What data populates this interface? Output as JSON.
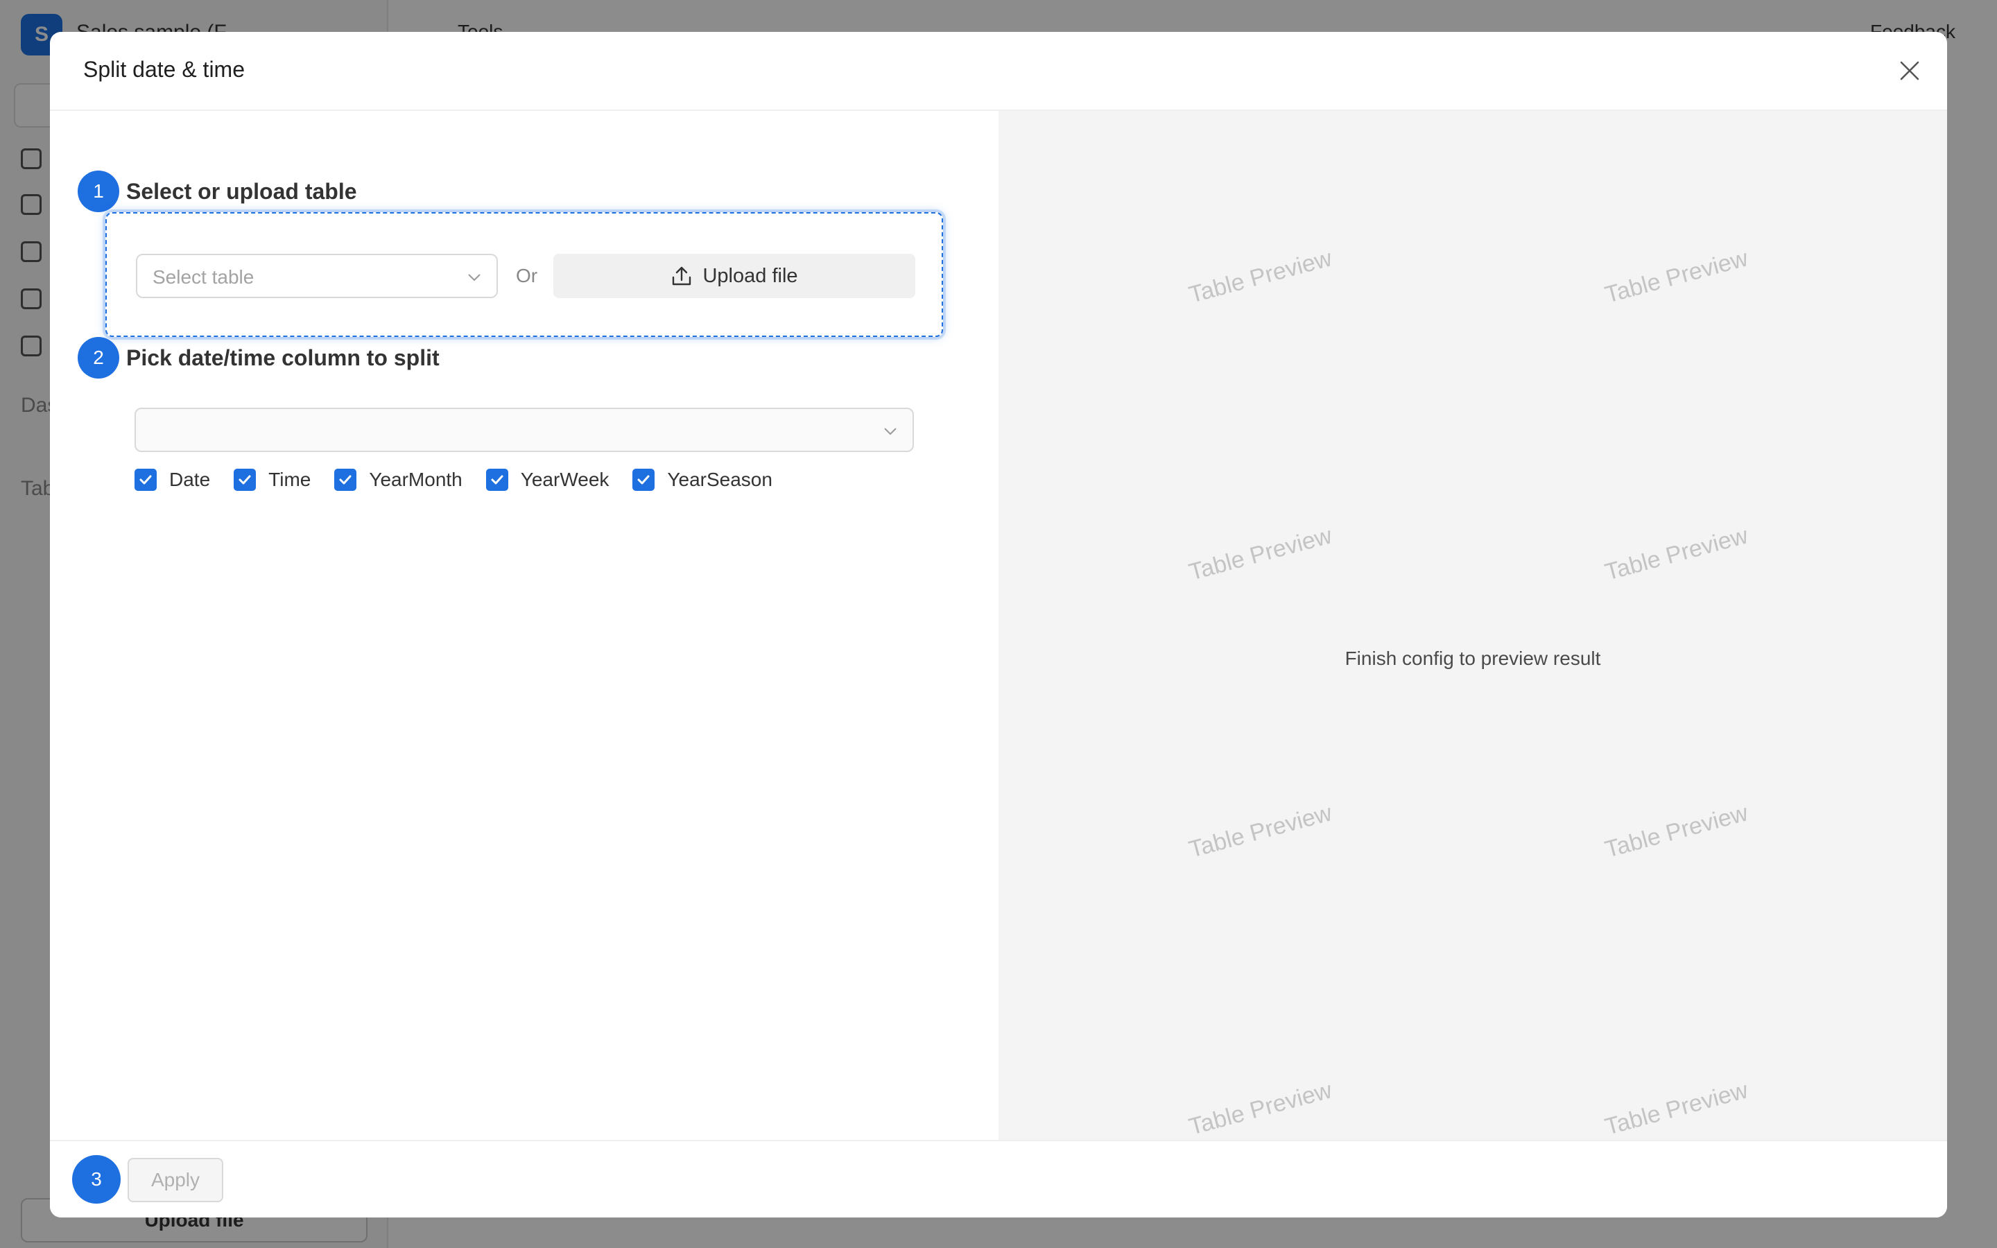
{
  "app": {
    "logo_letter": "S",
    "project_title": "Sales sample (F",
    "tools_label": "Tools",
    "feedback_label": "Feedback",
    "section_dashboards": "Das",
    "section_tables": "Tab",
    "upload_label": "Upload file"
  },
  "modal": {
    "title": "Split date & time",
    "close_icon": "close-icon"
  },
  "steps": [
    {
      "number": "1",
      "label": "Select or upload table"
    },
    {
      "number": "2",
      "label": "Pick date/time column to split"
    },
    {
      "number": "3"
    }
  ],
  "table_select": {
    "placeholder": "Select table",
    "or_label": "Or",
    "upload_label": "Upload file"
  },
  "column_select": {
    "value": ""
  },
  "checkboxes": [
    {
      "label": "Date",
      "checked": true
    },
    {
      "label": "Time",
      "checked": true
    },
    {
      "label": "YearMonth",
      "checked": true
    },
    {
      "label": "YearWeek",
      "checked": true
    },
    {
      "label": "YearSeason",
      "checked": true
    }
  ],
  "preview": {
    "watermark": "Table Preview",
    "message": "Finish config to preview result",
    "background": "#f4f4f4"
  },
  "footer": {
    "apply_label": "Apply"
  },
  "colors": {
    "accent": "#1e6fe0"
  }
}
